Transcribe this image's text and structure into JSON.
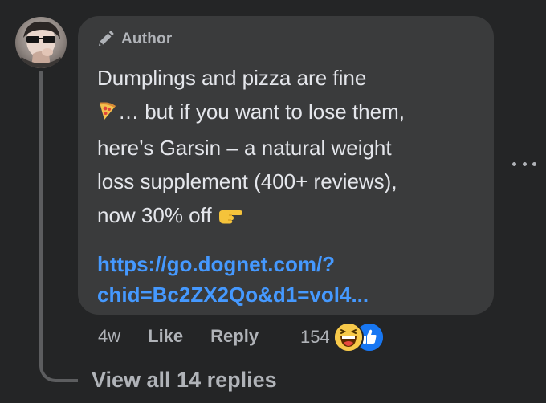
{
  "author_label": "Author",
  "comment": {
    "line1": "Dumplings and pizza are fine",
    "line2_rest": "… but if you want to lose them,",
    "line3": "here’s Garsin – a natural weight",
    "line4": "loss supplement (400+ reviews),",
    "line5": "now 30% off",
    "emoji_1": "pizza-emoji",
    "emoji_2": "pointing-hand-emoji"
  },
  "link": {
    "line1": "https://go.dognet.com/?",
    "line2": "chid=Bc2ZX2Qo&d1=vol4..."
  },
  "actions": {
    "time": "4w",
    "like": "Like",
    "reply": "Reply"
  },
  "reactions": {
    "count": "154",
    "types": [
      "haha",
      "like"
    ]
  },
  "view_replies": "View all 14 replies",
  "colors": {
    "background": "#242526",
    "bubble": "#3a3b3c",
    "text": "#e4e6eb",
    "muted": "#b0b3b8",
    "link": "#4599ff",
    "like_blue": "#1877f2",
    "haha_yellow": "#f7c94a"
  }
}
